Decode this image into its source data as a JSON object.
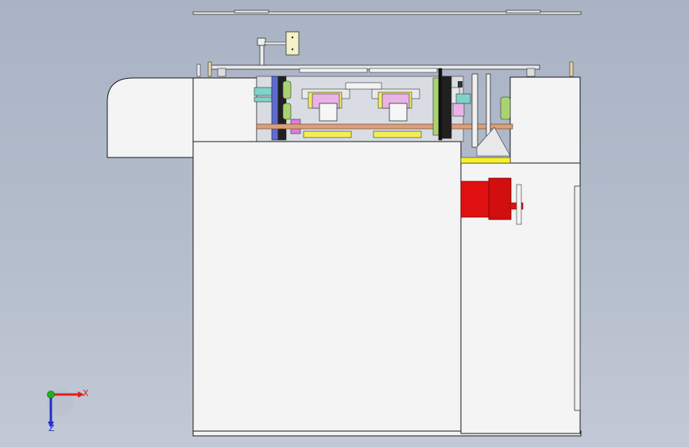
{
  "viewport": {
    "background_top": "#a9b3c4",
    "background_bottom": "#c2c9d6"
  },
  "colors": {
    "housing_fill": "#f4f4f4",
    "housing_stroke": "#1a1a1a",
    "mechanism_pink": "#e9b3e6",
    "mechanism_yellow": "#f2ee5a",
    "mechanism_green": "#a9d36f",
    "mechanism_teal": "#7fd3c9",
    "mechanism_blue": "#6c78d8",
    "shaft_copper": "#d8a07c",
    "motor_red": "#e01010",
    "accent_yellow": "#f6f02a"
  },
  "triad": {
    "x_label": "X",
    "z_label": "Z",
    "x_color": "#e02020",
    "y_color": "#20b020",
    "z_color": "#2030d0"
  }
}
